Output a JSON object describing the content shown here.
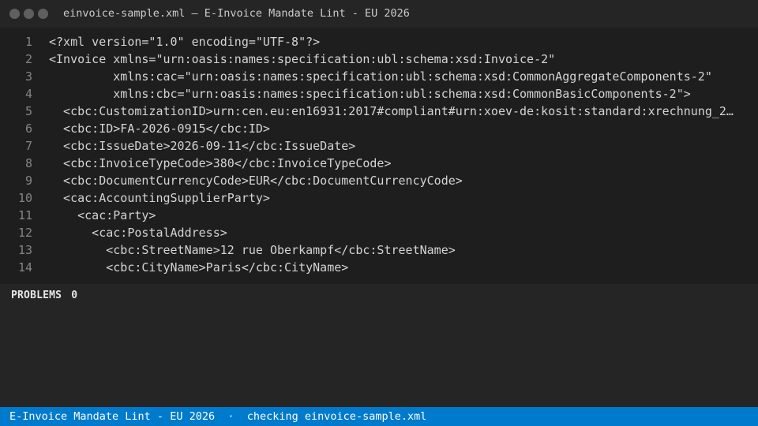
{
  "window": {
    "title": "einvoice-sample.xml — E-Invoice Mandate Lint - EU 2026"
  },
  "editor": {
    "lines": [
      {
        "num": "1",
        "text": "<?xml version=\"1.0\" encoding=\"UTF-8\"?>"
      },
      {
        "num": "2",
        "text": "<Invoice xmlns=\"urn:oasis:names:specification:ubl:schema:xsd:Invoice-2\""
      },
      {
        "num": "3",
        "text": "         xmlns:cac=\"urn:oasis:names:specification:ubl:schema:xsd:CommonAggregateComponents-2\""
      },
      {
        "num": "4",
        "text": "         xmlns:cbc=\"urn:oasis:names:specification:ubl:schema:xsd:CommonBasicComponents-2\">"
      },
      {
        "num": "5",
        "text": "  <cbc:CustomizationID>urn:cen.eu:en16931:2017#compliant#urn:xoev-de:kosit:standard:xrechnung_2…"
      },
      {
        "num": "6",
        "text": "  <cbc:ID>FA-2026-0915</cbc:ID>"
      },
      {
        "num": "7",
        "text": "  <cbc:IssueDate>2026-09-11</cbc:IssueDate>"
      },
      {
        "num": "8",
        "text": "  <cbc:InvoiceTypeCode>380</cbc:InvoiceTypeCode>"
      },
      {
        "num": "9",
        "text": "  <cbc:DocumentCurrencyCode>EUR</cbc:DocumentCurrencyCode>"
      },
      {
        "num": "10",
        "text": "  <cac:AccountingSupplierParty>"
      },
      {
        "num": "11",
        "text": "    <cac:Party>"
      },
      {
        "num": "12",
        "text": "      <cac:PostalAddress>"
      },
      {
        "num": "13",
        "text": "        <cbc:StreetName>12 rue Oberkampf</cbc:StreetName>"
      },
      {
        "num": "14",
        "text": "        <cbc:CityName>Paris</cbc:CityName>"
      }
    ]
  },
  "problems_panel": {
    "label": "PROBLEMS",
    "count": "0"
  },
  "status_bar": {
    "extension": "E-Invoice Mandate Lint - EU 2026",
    "separator": "·",
    "message": "checking einvoice-sample.xml"
  },
  "colors": {
    "titlebar_bg": "#252526",
    "editor_bg": "#1e1e1e",
    "status_bar_bg": "#007acc",
    "line_number": "#858585",
    "text": "#d4d4d4"
  }
}
